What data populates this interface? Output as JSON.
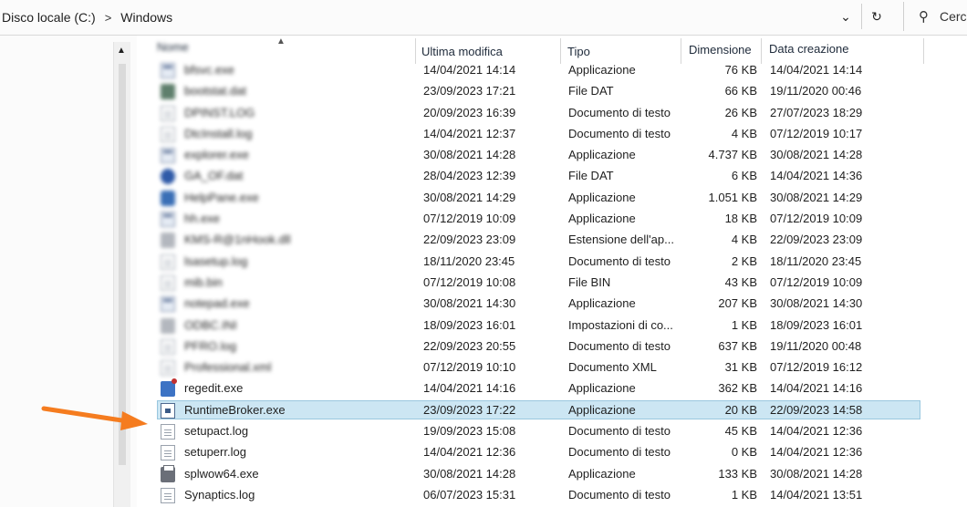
{
  "address": {
    "crumbs": [
      "Disco locale (C:)",
      "Windows"
    ],
    "separator": ">",
    "search_placeholder": "Cerc",
    "dropdown_icon": "chevron-down-icon",
    "refresh_icon": "refresh-icon",
    "search_icon": "search-icon"
  },
  "columns": {
    "name": "Nome",
    "modified": "Ultima modifica",
    "type": "Tipo",
    "size": "Dimensione",
    "created": "Data creazione"
  },
  "rows": [
    {
      "name": "bfsvc.exe",
      "modified": "14/04/2021 14:14",
      "type": "Applicazione",
      "size": "76 KB",
      "created": "14/04/2021 14:14",
      "icon": "app",
      "blurred": true
    },
    {
      "name": "bootstat.dat",
      "modified": "23/09/2023 17:21",
      "type": "File DAT",
      "size": "66 KB",
      "created": "19/11/2020 00:46",
      "icon": "dat",
      "blurred": true
    },
    {
      "name": "DPINST.LOG",
      "modified": "20/09/2023 16:39",
      "type": "Documento di testo",
      "size": "26 KB",
      "created": "27/07/2023 18:29",
      "icon": "doc",
      "blurred": true
    },
    {
      "name": "DtcInstall.log",
      "modified": "14/04/2021 12:37",
      "type": "Documento di testo",
      "size": "4 KB",
      "created": "07/12/2019 10:17",
      "icon": "doc",
      "blurred": true
    },
    {
      "name": "explorer.exe",
      "modified": "30/08/2021 14:28",
      "type": "Applicazione",
      "size": "4.737 KB",
      "created": "30/08/2021 14:28",
      "icon": "app",
      "blurred": true
    },
    {
      "name": "GA_OF.dat",
      "modified": "28/04/2023 12:39",
      "type": "File DAT",
      "size": "6 KB",
      "created": "14/04/2021 14:36",
      "icon": "globe",
      "blurred": true
    },
    {
      "name": "HelpPane.exe",
      "modified": "30/08/2021 14:29",
      "type": "Applicazione",
      "size": "1.051 KB",
      "created": "30/08/2021 14:29",
      "icon": "ie",
      "blurred": true
    },
    {
      "name": "hh.exe",
      "modified": "07/12/2019 10:09",
      "type": "Applicazione",
      "size": "18 KB",
      "created": "07/12/2019 10:09",
      "icon": "app",
      "blurred": true
    },
    {
      "name": "KMS-R@1nHook.dll",
      "modified": "22/09/2023 23:09",
      "type": "Estensione dell'ap...",
      "size": "4 KB",
      "created": "22/09/2023 23:09",
      "icon": "cfg",
      "blurred": true
    },
    {
      "name": "lsasetup.log",
      "modified": "18/11/2020 23:45",
      "type": "Documento di testo",
      "size": "2 KB",
      "created": "18/11/2020 23:45",
      "icon": "doc",
      "blurred": true
    },
    {
      "name": "mib.bin",
      "modified": "07/12/2019 10:08",
      "type": "File BIN",
      "size": "43 KB",
      "created": "07/12/2019 10:09",
      "icon": "doc",
      "blurred": true
    },
    {
      "name": "notepad.exe",
      "modified": "30/08/2021 14:30",
      "type": "Applicazione",
      "size": "207 KB",
      "created": "30/08/2021 14:30",
      "icon": "app",
      "blurred": true
    },
    {
      "name": "ODBC.INI",
      "modified": "18/09/2023 16:01",
      "type": "Impostazioni di co...",
      "size": "1 KB",
      "created": "18/09/2023 16:01",
      "icon": "cfg",
      "blurred": true
    },
    {
      "name": "PFRO.log",
      "modified": "22/09/2023 20:55",
      "type": "Documento di testo",
      "size": "637 KB",
      "created": "19/11/2020 00:48",
      "icon": "doc",
      "blurred": true
    },
    {
      "name": "Professional.xml",
      "modified": "07/12/2019 10:10",
      "type": "Documento XML",
      "size": "31 KB",
      "created": "07/12/2019 16:12",
      "icon": "doc",
      "blurred": true
    },
    {
      "name": "regedit.exe",
      "modified": "14/04/2021 14:16",
      "type": "Applicazione",
      "size": "362 KB",
      "created": "14/04/2021 14:16",
      "icon": "reg",
      "blurred": false
    },
    {
      "name": "RuntimeBroker.exe",
      "modified": "23/09/2023 17:22",
      "type": "Applicazione",
      "size": "20 KB",
      "created": "22/09/2023 14:58",
      "icon": "runtime",
      "blurred": false,
      "selected": true
    },
    {
      "name": "setupact.log",
      "modified": "19/09/2023 15:08",
      "type": "Documento di testo",
      "size": "45 KB",
      "created": "14/04/2021 12:36",
      "icon": "doc",
      "blurred": false
    },
    {
      "name": "setuperr.log",
      "modified": "14/04/2021 12:36",
      "type": "Documento di testo",
      "size": "0 KB",
      "created": "14/04/2021 12:36",
      "icon": "doc",
      "blurred": false
    },
    {
      "name": "splwow64.exe",
      "modified": "30/08/2021 14:28",
      "type": "Applicazione",
      "size": "133 KB",
      "created": "30/08/2021 14:28",
      "icon": "printer",
      "blurred": false
    },
    {
      "name": "Synaptics.log",
      "modified": "06/07/2023 15:31",
      "type": "Documento di testo",
      "size": "1 KB",
      "created": "14/04/2021 13:51",
      "icon": "doc",
      "blurred": false
    }
  ],
  "annotation": {
    "arrow_color": "#f57c1f",
    "points_to": "RuntimeBroker.exe"
  },
  "colors": {
    "selection": "#cce6f3",
    "selection_border": "#99c7df",
    "header_text": "#1e2a3a"
  }
}
